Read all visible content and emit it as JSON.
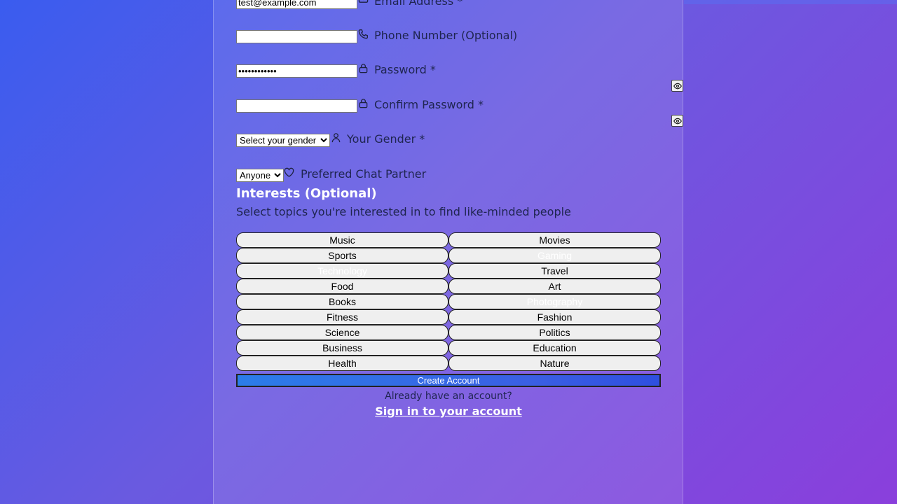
{
  "form": {
    "email": {
      "value": "test@example.com",
      "label": "Email Address *",
      "icon": "mail-icon"
    },
    "phone": {
      "value": "",
      "label": "Phone Number (Optional)",
      "icon": "phone-icon"
    },
    "password": {
      "value": "••••••••••••",
      "label": "Password *",
      "icon": "lock-icon"
    },
    "confirm_password": {
      "value": "",
      "label": "Confirm Password *",
      "icon": "lock-icon"
    },
    "gender": {
      "selected": "Select your gender",
      "label": "Your Gender *",
      "icon": "user-icon"
    },
    "chat_partner": {
      "selected": "Anyone",
      "label": "Preferred Chat Partner",
      "icon": "heart-icon"
    }
  },
  "interests": {
    "title": "Interests (Optional)",
    "subtitle": "Select topics you're interested in to find like-minded people",
    "items": [
      {
        "label": "Music",
        "selected": false
      },
      {
        "label": "Movies",
        "selected": false
      },
      {
        "label": "Sports",
        "selected": false
      },
      {
        "label": "Gaming",
        "selected": true
      },
      {
        "label": "Technology",
        "selected": true
      },
      {
        "label": "Travel",
        "selected": false
      },
      {
        "label": "Food",
        "selected": false
      },
      {
        "label": "Art",
        "selected": false
      },
      {
        "label": "Books",
        "selected": false
      },
      {
        "label": "Photography",
        "selected": true
      },
      {
        "label": "Fitness",
        "selected": false
      },
      {
        "label": "Fashion",
        "selected": false
      },
      {
        "label": "Science",
        "selected": false
      },
      {
        "label": "Politics",
        "selected": false
      },
      {
        "label": "Business",
        "selected": false
      },
      {
        "label": "Education",
        "selected": false
      },
      {
        "label": "Health",
        "selected": false
      },
      {
        "label": "Nature",
        "selected": false
      }
    ]
  },
  "actions": {
    "create_label": "Create Account",
    "already_text": "Already have an account?",
    "signin_label": "Sign in to your account"
  },
  "colors": {
    "accent": "#3a5fe3",
    "label_text": "#1f2550",
    "heading_text": "#ffffff"
  }
}
